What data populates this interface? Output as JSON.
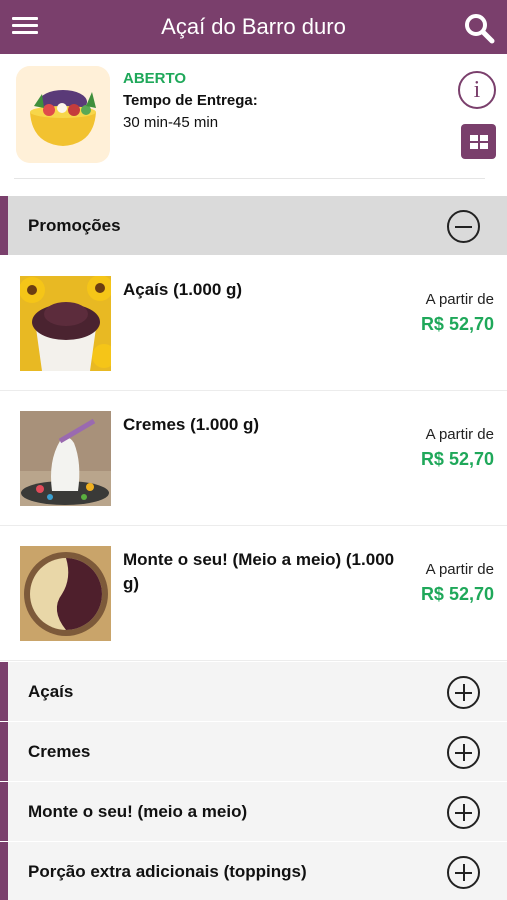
{
  "header": {
    "title": "Açaí do Barro duro",
    "menu_icon": "hamburger-menu-icon",
    "search_icon": "search-icon"
  },
  "store": {
    "status": "ABERTO",
    "delivery_label": "Tempo de Entrega:",
    "delivery_time": "30 min-45 min",
    "info_glyph": "i",
    "status_color": "#1fa85a",
    "brand_color": "#7a3f6c"
  },
  "promo_category": {
    "label": "Promoções",
    "items": [
      {
        "name": "Açaís (1.000 g)",
        "from_label": "A partir de",
        "price": "R$ 52,70"
      },
      {
        "name": "Cremes (1.000 g)",
        "from_label": "A partir de",
        "price": "R$ 52,70"
      },
      {
        "name": "Monte o seu! (Meio a meio) (1.000 g)",
        "from_label": "A partir de",
        "price": "R$ 52,70"
      }
    ]
  },
  "categories": [
    {
      "label": "Açaís"
    },
    {
      "label": "Cremes"
    },
    {
      "label": "Monte o seu! (meio a meio)"
    },
    {
      "label": "Porção extra adicionais (toppings)"
    }
  ]
}
